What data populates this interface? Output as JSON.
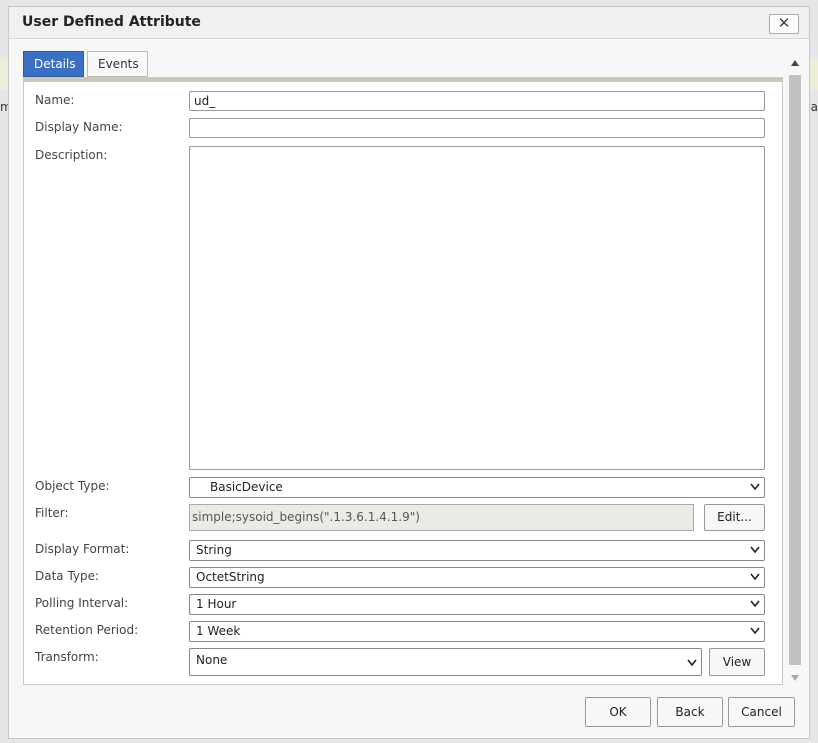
{
  "dialog": {
    "title": "User Defined Attribute",
    "close_symbol": "✕"
  },
  "tabs": [
    {
      "label": "Details",
      "active": true
    },
    {
      "label": "Events",
      "active": false
    }
  ],
  "form": {
    "name": {
      "label": "Name:",
      "value": "ud_"
    },
    "display_name": {
      "label": "Display Name:",
      "value": ""
    },
    "description": {
      "label": "Description:",
      "value": ""
    },
    "object_type": {
      "label": "Object Type:",
      "value": "BasicDevice"
    },
    "filter": {
      "label": "Filter:",
      "value": "simple;sysoid_begins(\".1.3.6.1.4.1.9\")",
      "edit_label": "Edit..."
    },
    "display_format": {
      "label": "Display Format:",
      "value": "String"
    },
    "data_type": {
      "label": "Data Type:",
      "value": "OctetString"
    },
    "polling_interval": {
      "label": "Polling Interval:",
      "value": "1 Hour"
    },
    "retention_period": {
      "label": "Retention Period:",
      "value": "1 Week"
    },
    "transform": {
      "label": "Transform:",
      "value": "None",
      "view_label": "View"
    }
  },
  "footer": {
    "ok": "OK",
    "back": "Back",
    "cancel": "Cancel"
  },
  "background": {
    "left_fragment": "m",
    "right_fragment": "va"
  },
  "colors": {
    "active_tab": "#3a6fc4",
    "banner": "#eeeed8"
  }
}
